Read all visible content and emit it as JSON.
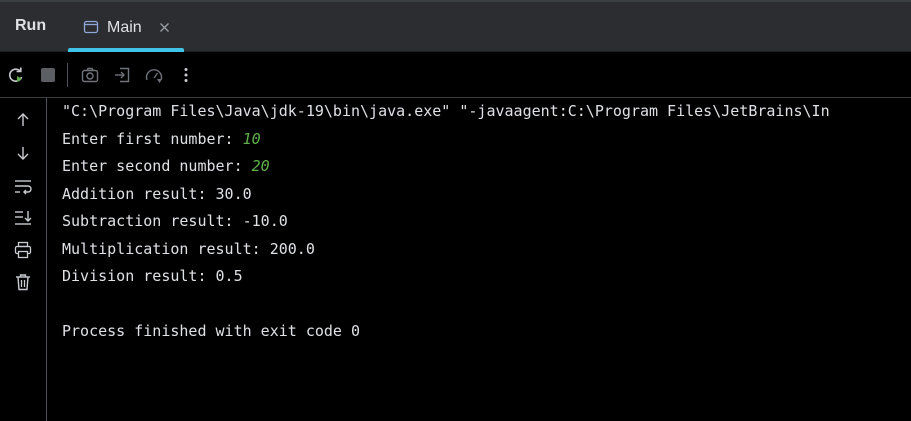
{
  "panel": {
    "title": "Run",
    "tab": {
      "label": "Main"
    }
  },
  "console": {
    "command": "\"C:\\Program Files\\Java\\jdk-19\\bin\\java.exe\" \"-javaagent:C:\\Program Files\\JetBrains\\In",
    "prompt1": "Enter first number: ",
    "input1": "10",
    "prompt2": "Enter second number: ",
    "input2": "20",
    "addition": "Addition result: 30.0",
    "subtraction": "Subtraction result: -10.0",
    "multiplication": "Multiplication result: 200.0",
    "division": "Division result: 0.5",
    "exit": "Process finished with exit code 0"
  },
  "colors": {
    "accent": "#3fc4e8",
    "user_input": "#5fb04a",
    "background": "#000000",
    "header": "#2b2d30"
  },
  "icons": {
    "tab": "console-icon",
    "close": "close-icon",
    "toolbar": [
      "rerun-icon",
      "stop-icon",
      "camera-icon",
      "exit-icon",
      "profiler-icon",
      "more-icon"
    ],
    "gutter": [
      "arrow-up-icon",
      "arrow-down-icon",
      "soft-wrap-icon",
      "scroll-to-end-icon",
      "print-icon",
      "trash-icon"
    ]
  }
}
